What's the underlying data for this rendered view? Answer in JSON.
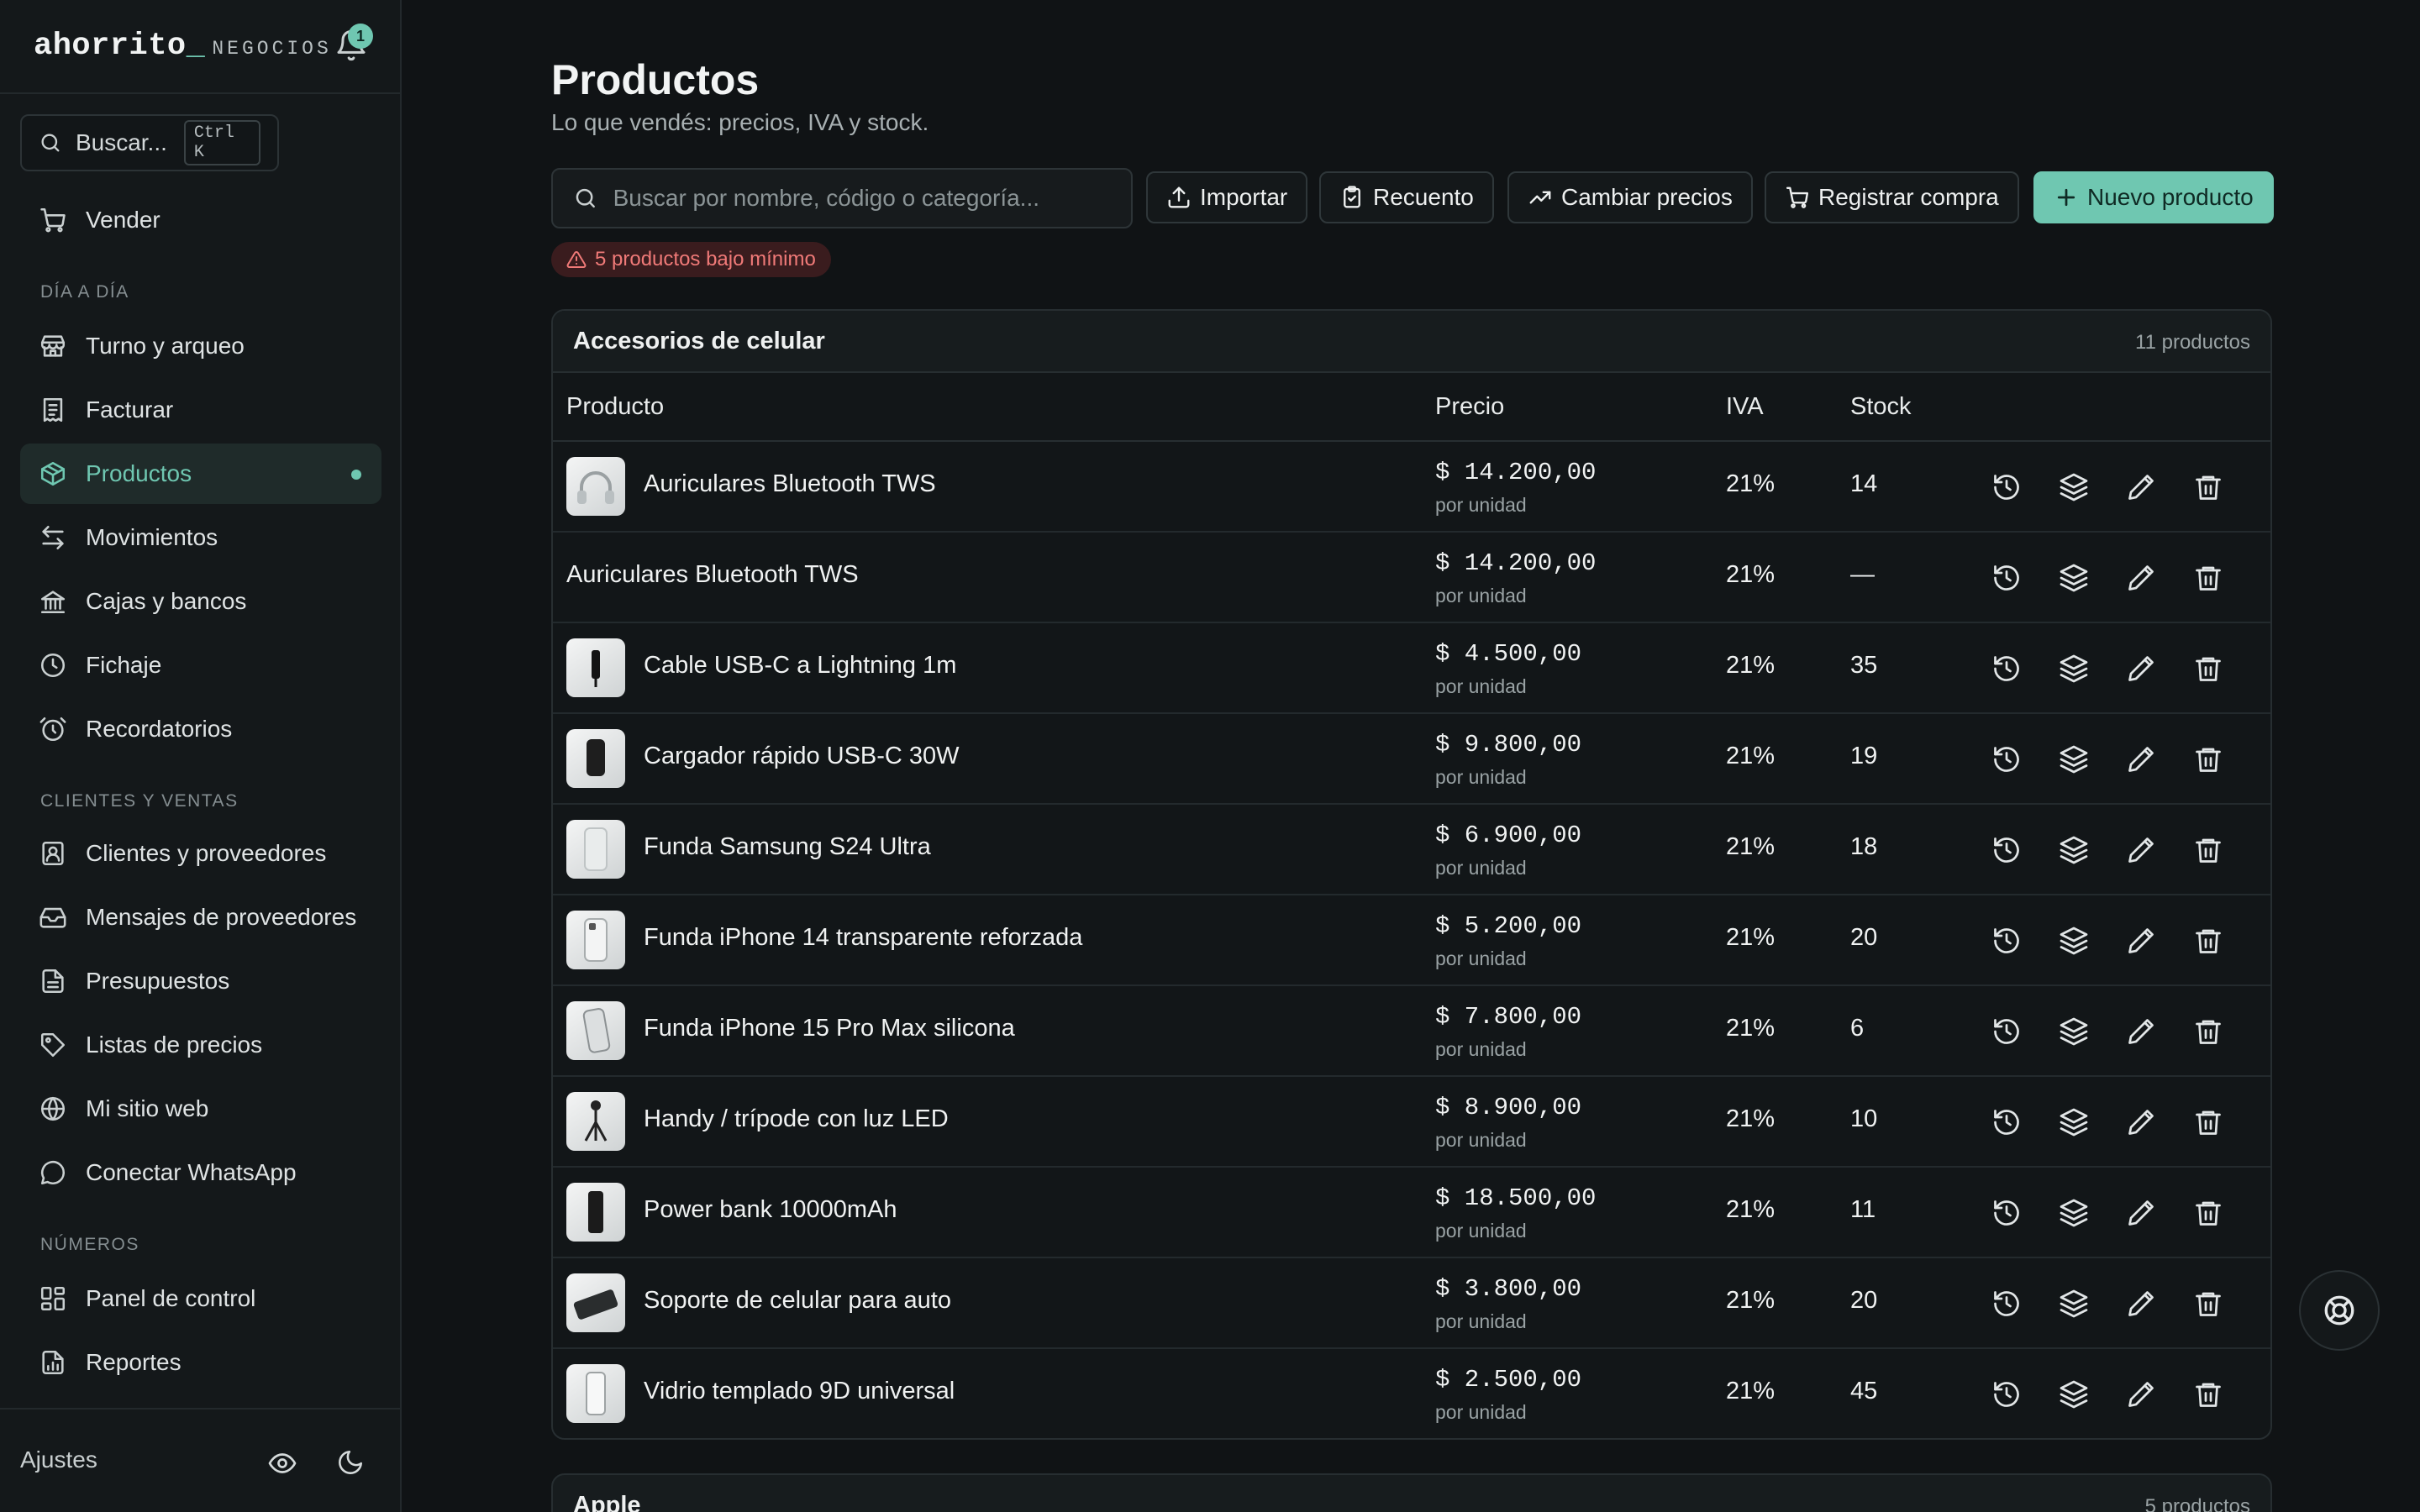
{
  "brand": {
    "logo": "ahorrito",
    "cursor": "_",
    "sub": "NEGOCIOS",
    "notifications": "1"
  },
  "sidebar": {
    "search_label": "Buscar...",
    "search_shortcut": "Ctrl K",
    "sell": {
      "label": "Vender",
      "icon": "cart-icon"
    },
    "sections": [
      "DÍA A DÍA",
      "CLIENTES Y VENTAS",
      "NÚMEROS"
    ],
    "items": [
      {
        "label": "Turno y arqueo",
        "icon": "store-icon"
      },
      {
        "label": "Facturar",
        "icon": "receipt-icon"
      },
      {
        "label": "Productos",
        "icon": "box-icon",
        "active": true
      },
      {
        "label": "Movimientos",
        "icon": "arrows-icon"
      },
      {
        "label": "Cajas y bancos",
        "icon": "bank-icon"
      },
      {
        "label": "Fichaje",
        "icon": "clock-icon"
      },
      {
        "label": "Recordatorios",
        "icon": "alarm-icon"
      },
      {
        "label": "Clientes y proveedores",
        "icon": "contact-icon"
      },
      {
        "label": "Mensajes de proveedores",
        "icon": "inbox-icon"
      },
      {
        "label": "Presupuestos",
        "icon": "document-icon"
      },
      {
        "label": "Listas de precios",
        "icon": "tag-icon"
      },
      {
        "label": "Mi sitio web",
        "icon": "globe-icon"
      },
      {
        "label": "Conectar WhatsApp",
        "icon": "chat-icon"
      },
      {
        "label": "Panel de control",
        "icon": "dashboard-icon"
      },
      {
        "label": "Reportes",
        "icon": "report-icon"
      }
    ],
    "settings_label": "Ajustes"
  },
  "page": {
    "title": "Productos",
    "subtitle": "Lo que vendés: precios, IVA y stock.",
    "search_placeholder": "Buscar por nombre, código o categoría...",
    "buttons": {
      "import": "Importar",
      "count": "Recuento",
      "change_prices": "Cambiar precios",
      "register_purchase": "Registrar compra",
      "new_product": "Nuevo producto"
    },
    "low_stock_warning": "5 productos bajo mínimo"
  },
  "table": {
    "headers": {
      "product": "Producto",
      "price": "Precio",
      "iva": "IVA",
      "stock": "Stock"
    },
    "groups": [
      {
        "name": "Accesorios de celular",
        "count": "11 productos",
        "rows": [
          {
            "name": "Auriculares Bluetooth TWS",
            "price": "$ 14.200,00",
            "unit": "por unidad",
            "iva": "21%",
            "stock": "14",
            "thumb": "headphones"
          },
          {
            "name": "Auriculares Bluetooth TWS",
            "price": "$ 14.200,00",
            "unit": "por unidad",
            "iva": "21%",
            "stock": "—",
            "thumb": ""
          },
          {
            "name": "Cable USB-C a Lightning 1m",
            "price": "$ 4.500,00",
            "unit": "por unidad",
            "iva": "21%",
            "stock": "35",
            "thumb": "cable"
          },
          {
            "name": "Cargador rápido USB-C 30W",
            "price": "$ 9.800,00",
            "unit": "por unidad",
            "iva": "21%",
            "stock": "19",
            "thumb": "charger"
          },
          {
            "name": "Funda Samsung S24 Ultra",
            "price": "$ 6.900,00",
            "unit": "por unidad",
            "iva": "21%",
            "stock": "18",
            "thumb": "case-white"
          },
          {
            "name": "Funda iPhone 14 transparente reforzada",
            "price": "$ 5.200,00",
            "unit": "por unidad",
            "iva": "21%",
            "stock": "20",
            "thumb": "case-clear"
          },
          {
            "name": "Funda iPhone 15 Pro Max silicona",
            "price": "$ 7.800,00",
            "unit": "por unidad",
            "iva": "21%",
            "stock": "6",
            "thumb": "case-silicone"
          },
          {
            "name": "Handy / trípode con luz LED",
            "price": "$ 8.900,00",
            "unit": "por unidad",
            "iva": "21%",
            "stock": "10",
            "thumb": "tripod"
          },
          {
            "name": "Power bank 10000mAh",
            "price": "$ 18.500,00",
            "unit": "por unidad",
            "iva": "21%",
            "stock": "11",
            "thumb": "powerbank"
          },
          {
            "name": "Soporte de celular para auto",
            "price": "$ 3.800,00",
            "unit": "por unidad",
            "iva": "21%",
            "stock": "20",
            "thumb": "car-mount"
          },
          {
            "name": "Vidrio templado 9D universal",
            "price": "$ 2.500,00",
            "unit": "por unidad",
            "iva": "21%",
            "stock": "45",
            "thumb": "glass"
          }
        ]
      },
      {
        "name": "Apple",
        "count": "5 productos"
      }
    ]
  },
  "colors": {
    "accent": "#6fc7b1",
    "background": "#101315",
    "danger": "#f07a78"
  }
}
